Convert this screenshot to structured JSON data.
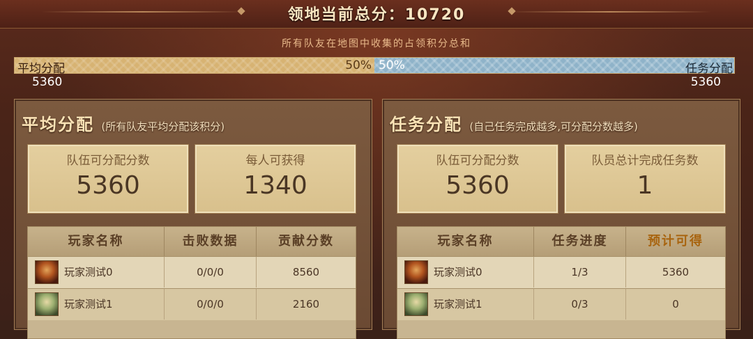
{
  "header": {
    "title": "领地当前总分：10720",
    "subtitle": "所有队友在地图中收集的占领积分总和"
  },
  "split": {
    "left_name": "平均分配",
    "left_percent_label": "50%",
    "left_value": "5360",
    "right_name": "任务分配",
    "right_percent_label": "50%",
    "right_value": "5360",
    "left_fraction": 0.5,
    "left_color": "#d7b373",
    "right_color": "#8fb3c9"
  },
  "average_panel": {
    "title": "平均分配",
    "note": "(所有队友平均分配该积分)",
    "stat1_label": "队伍可分配分数",
    "stat1_value": "5360",
    "stat2_label": "每人可获得",
    "stat2_value": "1340",
    "columns": [
      "玩家名称",
      "击败数据",
      "贡献分数"
    ],
    "rows": [
      {
        "name": "玩家测试0",
        "stats": "0/0/0",
        "score": "8560"
      },
      {
        "name": "玩家测试1",
        "stats": "0/0/0",
        "score": "2160"
      }
    ]
  },
  "task_panel": {
    "title": "任务分配",
    "note": "(自己任务完成越多,可分配分数越多)",
    "stat1_label": "队伍可分配分数",
    "stat1_value": "5360",
    "stat2_label": "队员总计完成任务数",
    "stat2_value": "1",
    "columns": [
      "玩家名称",
      "任务进度",
      "预计可得"
    ],
    "rows": [
      {
        "name": "玩家测试0",
        "progress": "1/3",
        "expected": "5360"
      },
      {
        "name": "玩家测试1",
        "progress": "0/3",
        "expected": "0"
      }
    ]
  }
}
